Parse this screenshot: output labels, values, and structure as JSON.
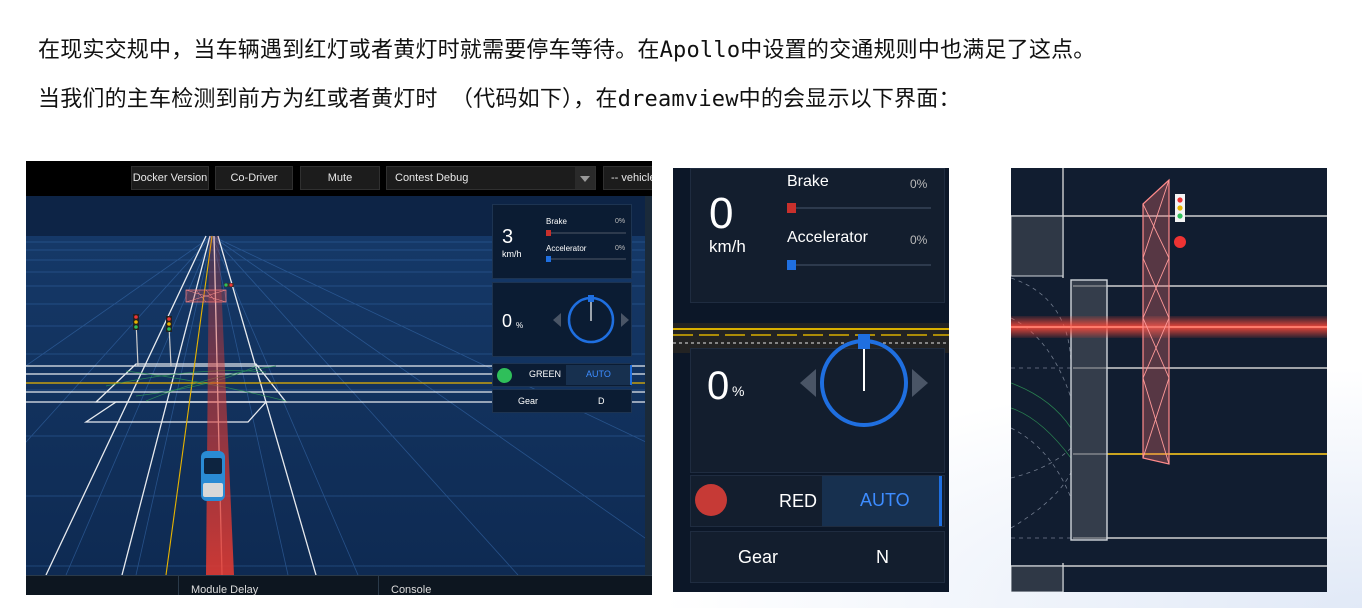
{
  "intro": {
    "line1": "在现实交规中，当车辆遇到红灯或者黄灯时就需要停车等待。在Apollo中设置的交通规则中也满足了这点。",
    "line2": "当我们的主车检测到前方为红或者黄灯时 （代码如下），在dreamview中的会显示以下界面："
  },
  "panel1": {
    "toolbar": {
      "docker_version": "Docker Version",
      "co_driver": "Co-Driver",
      "mute": "Mute",
      "mode_select": "Contest Debug",
      "vehicle_select": "-- vehicle"
    },
    "speed": {
      "value": "3",
      "unit": "km/h"
    },
    "brake": {
      "label": "Brake",
      "percent": "0%",
      "level": 0
    },
    "accelerator": {
      "label": "Accelerator",
      "percent": "0%",
      "level": 0
    },
    "steering": {
      "value": "0",
      "unit": "%"
    },
    "signal": {
      "label": "GREEN",
      "color": "#2fbf5a"
    },
    "drive_mode": "AUTO",
    "gear": {
      "label": "Gear",
      "value": "D"
    },
    "bottom_tabs": [
      "Module Delay",
      "Console"
    ]
  },
  "panel2": {
    "speed": {
      "value": "0",
      "unit": "km/h"
    },
    "brake": {
      "label": "Brake",
      "percent": "0%",
      "level": 0
    },
    "accelerator": {
      "label": "Accelerator",
      "percent": "0%",
      "level": 0
    },
    "steering": {
      "value": "0",
      "unit": "%"
    },
    "signal": {
      "label": "RED",
      "color": "#c63a36"
    },
    "drive_mode": "AUTO",
    "gear": {
      "label": "Gear",
      "value": "N"
    }
  },
  "colors": {
    "accent_blue": "#1f6fe0",
    "brake_red": "#c8302c",
    "scene_blue": "#0f2c55",
    "stop_line_red": "#e3342a"
  },
  "icons": {
    "steering": "steering-wheel-icon",
    "left_arrow": "chevron-left-icon",
    "right_arrow": "chevron-right-icon",
    "dropdown": "chevron-down-icon",
    "traffic_light": "traffic-light-icon"
  }
}
